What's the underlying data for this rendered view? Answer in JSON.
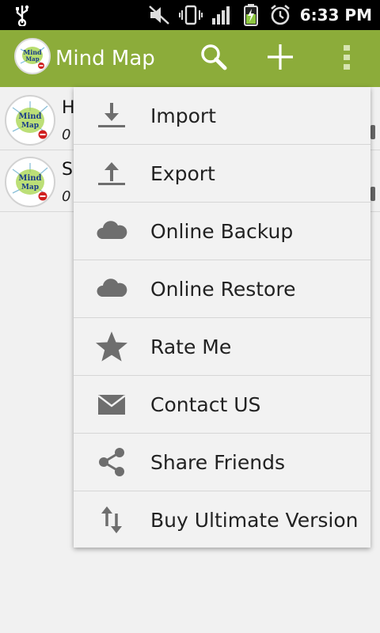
{
  "status_bar": {
    "time": "6:33 PM",
    "icons": [
      "usb-icon",
      "mute-icon",
      "vibrate-icon",
      "signal-icon",
      "battery-charging-icon",
      "alarm-icon"
    ]
  },
  "action_bar": {
    "title": "Mind Map",
    "logo_text": "Mind Map",
    "color": "#8cac3a",
    "actions": [
      "search-icon",
      "add-icon",
      "overflow-icon"
    ]
  },
  "list": {
    "rows": [
      {
        "title_visible": "H",
        "subtitle_visible": "0"
      },
      {
        "title_visible": "S",
        "subtitle_visible": "0"
      }
    ]
  },
  "menu": {
    "items": [
      {
        "label": "Import",
        "icon": "download-icon"
      },
      {
        "label": "Export",
        "icon": "upload-icon"
      },
      {
        "label": "Online Backup",
        "icon": "cloud-icon"
      },
      {
        "label": "Online Restore",
        "icon": "cloud-icon"
      },
      {
        "label": "Rate Me",
        "icon": "star-icon"
      },
      {
        "label": "Contact US",
        "icon": "mail-icon"
      },
      {
        "label": "Share Friends",
        "icon": "share-icon"
      },
      {
        "label": "Buy Ultimate Version",
        "icon": "swap-vertical-icon"
      }
    ]
  }
}
